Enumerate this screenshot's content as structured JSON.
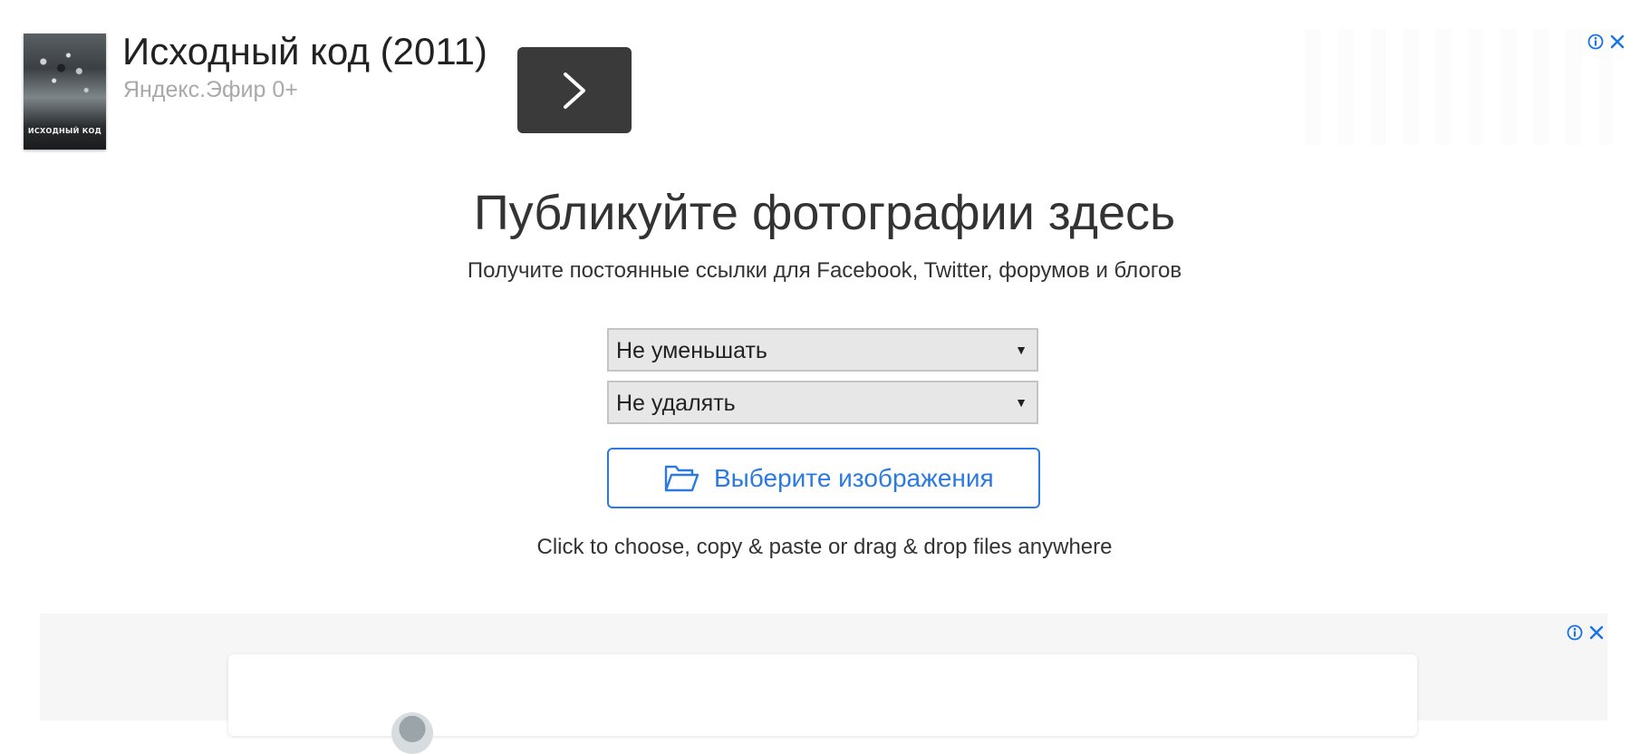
{
  "ad_top": {
    "title": "Исходный код (2011)",
    "source": "Яндекс.Эфир 0+",
    "poster_caption": "ИСХОДНЫЙ КОД",
    "go_icon": "chevron-right-icon",
    "info_icon": "info-icon",
    "close_icon": "close-icon"
  },
  "upload": {
    "title": "Публикуйте фотографии здесь",
    "subtitle": "Получите постоянные ссылки для Facebook, Twitter, форумов и блогов",
    "resize_select": {
      "value": "Не уменьшать"
    },
    "expire_select": {
      "value": "Не удалять"
    },
    "choose_button": {
      "label": "Выберите изображения",
      "icon": "folder-open-icon"
    },
    "hint": "Click to choose, copy & paste or drag & drop files anywhere"
  },
  "ad_bottom": {
    "info_icon": "info-icon",
    "close_icon": "close-icon"
  },
  "colors": {
    "accent": "#2a7ae2",
    "ad_button": "#3a3a3a",
    "select_bg": "#e7e7e7",
    "ad_icons": "#1a73e8",
    "muted_text": "#a9a9a9"
  }
}
